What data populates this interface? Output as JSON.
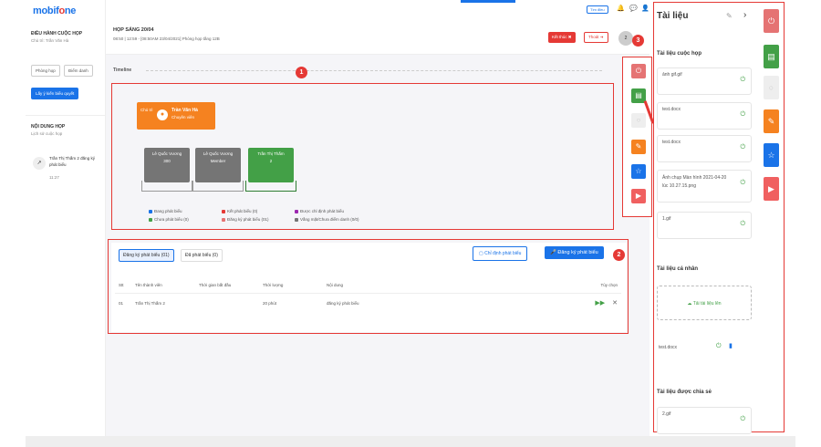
{
  "app": {
    "logo_prefix": "mobif",
    "logo_o": "o",
    "logo_suffix": "ne"
  },
  "left_panel": {
    "title": "ĐIỀU HÀNH CUỘC HỌP",
    "subtitle": "Chủ trì: Trần Văn Hà",
    "btn_room": "Phòng họp",
    "btn_attendance": "Điểm danh",
    "btn_feedback": "Lấy ý kiến biểu quyết",
    "content_title": "NỘI DUNG HỌP",
    "content_sub": "Lịch sử cuộc họp",
    "activity_text": "Trần Thị Thắm 2 đăng ký phát biểu",
    "activity_time": "11:27"
  },
  "header": {
    "meeting_title": "HỌP SÁNG 20/04",
    "meeting_time": "08:50 | 12:59 - [08:50AM 23/04/2021] Phòng họp tầng 12B",
    "btn_end": "Kết thúc",
    "btn_leave": "Thoát",
    "btn_top_right": "Tìm điều",
    "avatar_count": "2"
  },
  "timeline": {
    "label": "Timeline",
    "chair_role": "Chủ trì",
    "chair_name": "Trần Văn Hà",
    "chair_title": "Chuyên viên",
    "queue": [
      {
        "name": "Lê Quốc Vương",
        "detail": "300"
      },
      {
        "name": "Lê Quốc Vương",
        "detail": "Member"
      },
      {
        "name": "Trần Thị Thắm",
        "detail": "2"
      }
    ],
    "legend": [
      {
        "label": "Đang phát biểu",
        "color": "#1a73e8"
      },
      {
        "label": "Chưa phát biểu (0)",
        "color": "#43a047"
      },
      {
        "label": "Kết phát biểu (0)",
        "color": "#e53935"
      },
      {
        "label": "Đăng ký phát biểu (01)",
        "color": "#e57373"
      },
      {
        "label": "Được chỉ định phát biểu",
        "color": "#9c27b0"
      },
      {
        "label": "Vắng mặt/Chưa điểm danh (0/0)",
        "color": "#757575"
      }
    ]
  },
  "speech": {
    "tab_registered": "Đăng ký phát biểu (01)",
    "tab_spoken": "Đã phát biểu (0)",
    "btn_assign": "Chỉ định phát biểu",
    "btn_register": "Đăng ký phát biểu",
    "columns": [
      "Stt",
      "Tên thành viên",
      "Thời gian bắt đầu",
      "Thời lượng",
      "Nội dung",
      "Tùy chọn"
    ],
    "rows": [
      {
        "stt": "01",
        "name": "Trần Thị Thắm 2",
        "start": "",
        "duration": "20 phút",
        "content": "đăng ký phát biểu"
      }
    ]
  },
  "markers": [
    "1",
    "2",
    "3"
  ],
  "documents": {
    "title": "Tài liệu",
    "section_meeting": "Tài liệu cuộc họp",
    "meeting_docs": [
      "ảnh gif.gif",
      "test.docx",
      "test.docx",
      "Ảnh chụp Màn hình 2021-04-20 lúc 10.27.15.png",
      "1.gif"
    ],
    "section_personal": "Tài liệu cá nhân",
    "upload_label": "Tải tài liệu lên",
    "personal_docs": [
      "test.docx"
    ],
    "section_shared": "Tài liệu được chia sẻ",
    "shared_docs": [
      "2.gif"
    ]
  },
  "colors": {
    "accent": "#1a73e8",
    "chair": "#f58220",
    "queue_gray": "#757575",
    "queue_green": "#43a047",
    "marker": "#e53935"
  }
}
